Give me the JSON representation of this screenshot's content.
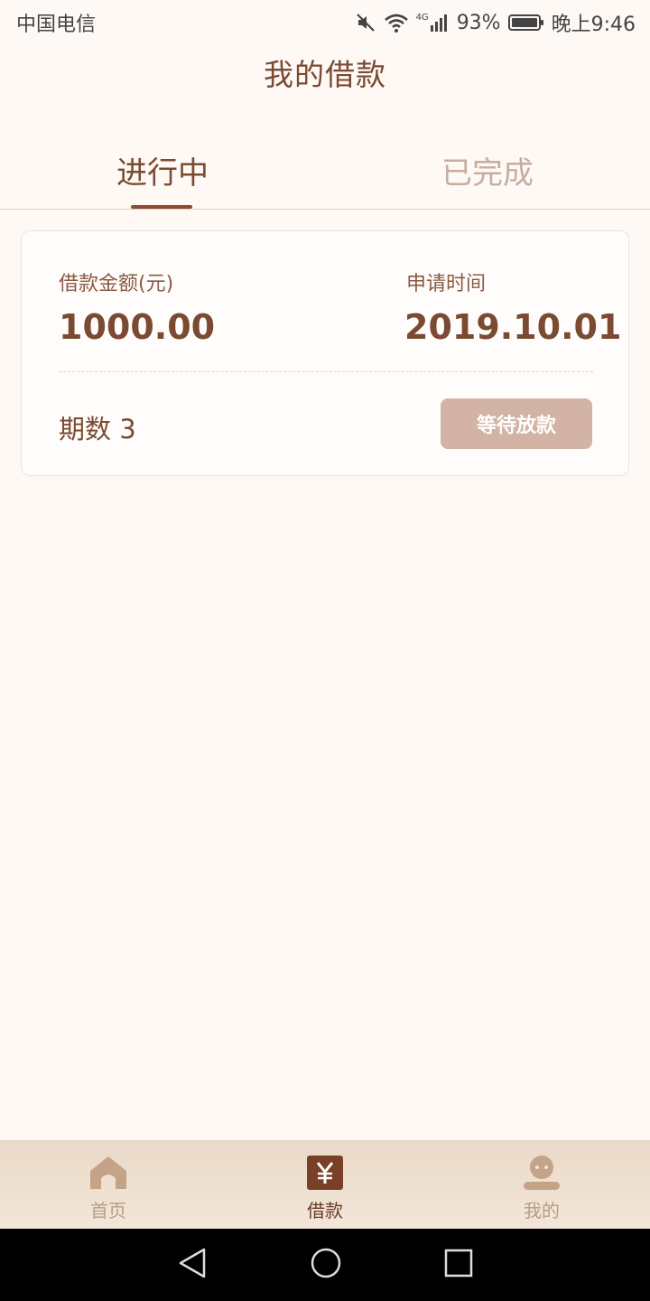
{
  "status_bar": {
    "carrier": "中国电信",
    "network": "4G",
    "battery": "93%",
    "time": "晚上9:46"
  },
  "header": {
    "title": "我的借款"
  },
  "tabs": [
    {
      "label": "进行中",
      "active": true
    },
    {
      "label": "已完成",
      "active": false
    }
  ],
  "loan_card": {
    "amount_label": "借款金额(元)",
    "amount_value": "1000.00",
    "date_label": "申请时间",
    "date_value": "2019.10.01",
    "periods_text": "期数 3",
    "status_label": "等待放款"
  },
  "bottom_nav": {
    "items": [
      {
        "label": "首页",
        "icon": "home-icon",
        "active": false
      },
      {
        "label": "借款",
        "icon": "yuan-icon",
        "active": true
      },
      {
        "label": "我的",
        "icon": "profile-icon",
        "active": false
      }
    ]
  },
  "colors": {
    "accent": "#8c4b2f",
    "background": "#fef9f5",
    "status_button": "#d2b3a5"
  }
}
